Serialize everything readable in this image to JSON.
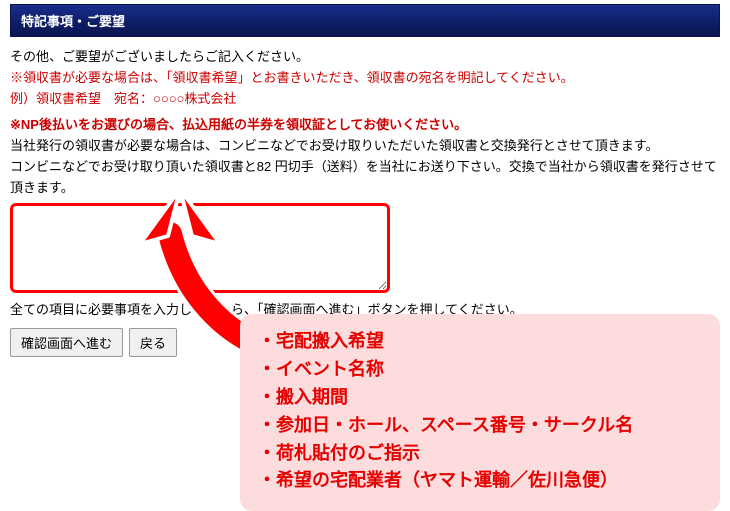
{
  "header": {
    "title": "特記事項・ご要望"
  },
  "instructions": {
    "line1": "その他、ご要望がございましたらご記入ください。",
    "line2": "※領収書が必要な場合は、「領収書希望」とお書きいただき、領収書の宛名を明記してください。",
    "line3": "例）領収書希望　宛名：○○○○株式会社",
    "line4": "※NP後払いをお選びの場合、払込用紙の半券を領収証としてお使いください。",
    "line5": "当社発行の領収書が必要な場合は、コンビニなどでお受け取りいただいた領収書と交換発行とさせて頂きます。",
    "line6": "コンビニなどでお受け取り頂いた領収書と82 円切手（送料）を当社にお送り下さい。交換で当社から領収書を発行させて頂きます。"
  },
  "textarea": {
    "value": "",
    "placeholder": ""
  },
  "below_note": "全ての項目に必要事項を入力しましたら、「確認画面へ進む」ボタンを押してください。",
  "buttons": {
    "confirm": "確認画面へ進む",
    "back": "戻る"
  },
  "callout": {
    "items": [
      "宅配搬入希望",
      "イベント名称",
      "搬入期間",
      "参加日・ホール、スペース番号・サークル名",
      "荷札貼付のご指示",
      "希望の宅配業者（ヤマト運輸／佐川急便）"
    ]
  }
}
